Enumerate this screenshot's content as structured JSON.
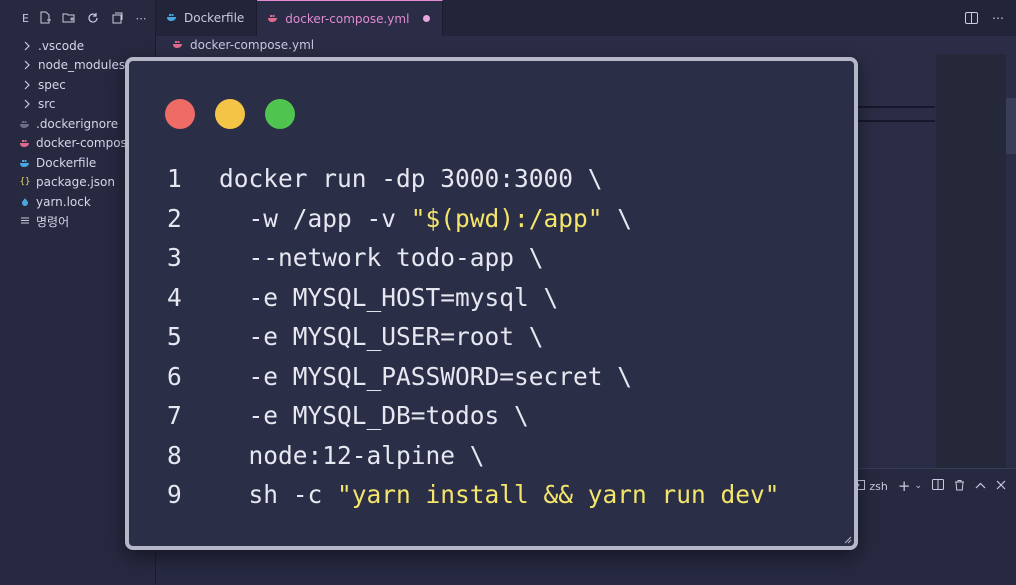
{
  "explorer": {
    "toolbar_letter": "E",
    "items": [
      {
        "label": ".vscode",
        "kind": "folder",
        "icon": "chevron-right-icon"
      },
      {
        "label": "node_modules",
        "kind": "folder",
        "icon": "chevron-right-icon"
      },
      {
        "label": "spec",
        "kind": "folder",
        "icon": "chevron-right-icon"
      },
      {
        "label": "src",
        "kind": "folder",
        "icon": "chevron-right-icon"
      },
      {
        "label": ".dockerignore",
        "kind": "file",
        "icon": "docker-icon",
        "color": "#6b6e86"
      },
      {
        "label": "docker-compose",
        "kind": "file",
        "icon": "docker-compose-icon",
        "color": "#e06b8e"
      },
      {
        "label": "Dockerfile",
        "kind": "file",
        "icon": "docker-icon",
        "color": "#4aa8e0"
      },
      {
        "label": "package.json",
        "kind": "file",
        "icon": "braces-icon",
        "color": "#e6d36a"
      },
      {
        "label": "yarn.lock",
        "kind": "file",
        "icon": "yarn-icon",
        "color": "#4aa8e0"
      },
      {
        "label": "명령어",
        "kind": "file",
        "icon": "text-file-icon",
        "color": "#c9cbe0"
      }
    ]
  },
  "tabs": [
    {
      "label": "Dockerfile",
      "active": false
    },
    {
      "label": "docker-compose.yml",
      "active": true,
      "modified": true
    }
  ],
  "breadcrumb": {
    "file": "docker-compose.yml"
  },
  "terminal": {
    "shell_label": "zsh"
  },
  "code_card": {
    "lines": [
      {
        "num": "1",
        "parts": [
          {
            "t": "docker run -dp 3000:3000 \\",
            "s": false
          }
        ]
      },
      {
        "num": "2",
        "parts": [
          {
            "t": "  -w /app -v ",
            "s": false
          },
          {
            "t": "\"$(pwd):/app\"",
            "s": true
          },
          {
            "t": " \\",
            "s": false
          }
        ]
      },
      {
        "num": "3",
        "parts": [
          {
            "t": "  --network todo-app \\",
            "s": false
          }
        ]
      },
      {
        "num": "4",
        "parts": [
          {
            "t": "  -e MYSQL_HOST=mysql \\",
            "s": false
          }
        ]
      },
      {
        "num": "5",
        "parts": [
          {
            "t": "  -e MYSQL_USER=root \\",
            "s": false
          }
        ]
      },
      {
        "num": "6",
        "parts": [
          {
            "t": "  -e MYSQL_PASSWORD=secret \\",
            "s": false
          }
        ]
      },
      {
        "num": "7",
        "parts": [
          {
            "t": "  -e MYSQL_DB=todos \\",
            "s": false
          }
        ]
      },
      {
        "num": "8",
        "parts": [
          {
            "t": "  node:12-alpine \\",
            "s": false
          }
        ]
      },
      {
        "num": "9",
        "parts": [
          {
            "t": "  sh -c ",
            "s": false
          },
          {
            "t": "\"yarn install && yarn run dev\"",
            "s": true
          }
        ]
      }
    ]
  },
  "colors": {
    "accent": "#e08bd3",
    "string": "#f4e56b",
    "traffic_red": "#ee6b66",
    "traffic_yellow": "#f4c446",
    "traffic_green": "#4fc44f"
  }
}
